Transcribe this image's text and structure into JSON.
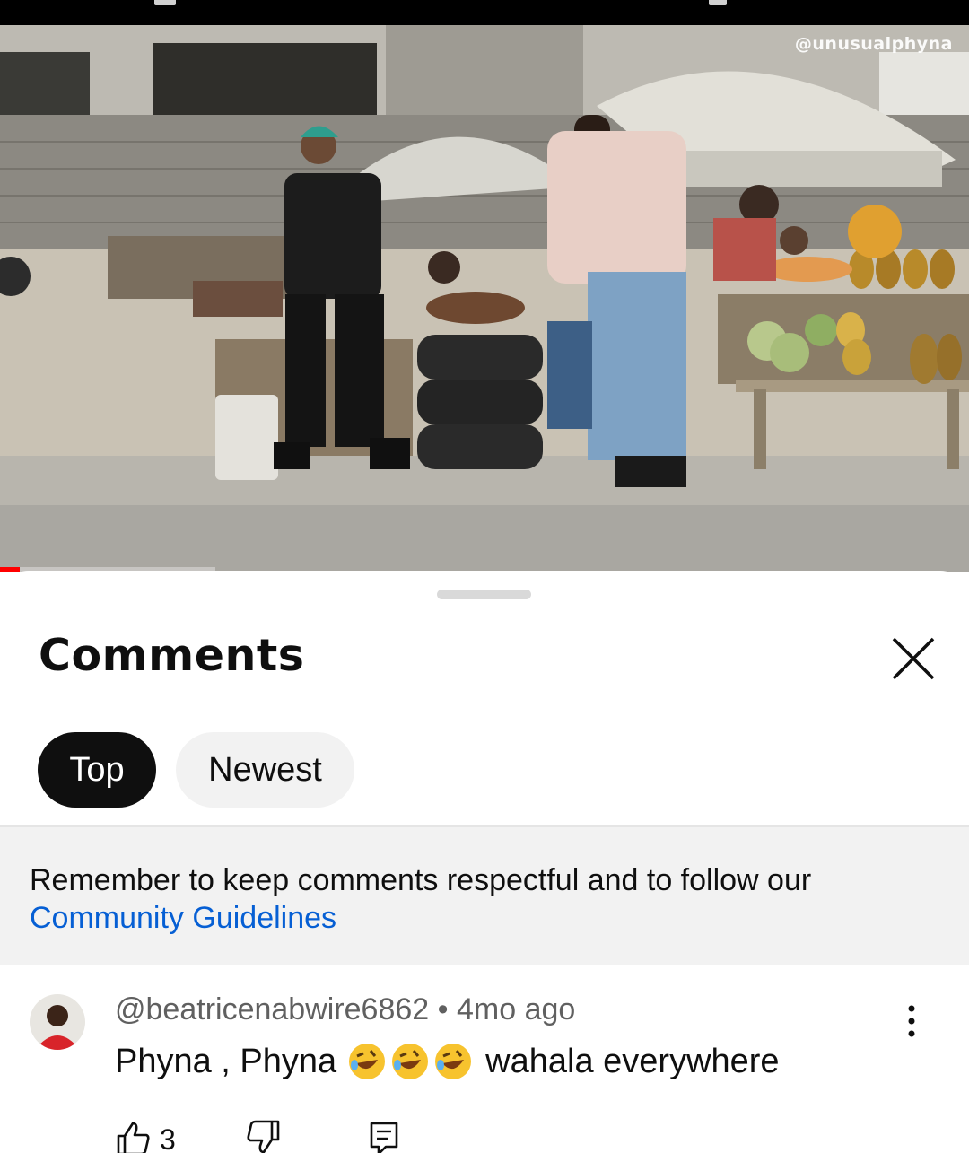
{
  "video": {
    "watermark": "@unusualphyna",
    "progress_fraction": 0.02
  },
  "comments_panel": {
    "title": "Comments",
    "close_icon": "close-icon",
    "sort_chips": [
      {
        "label": "Top",
        "selected": true
      },
      {
        "label": "Newest",
        "selected": false
      }
    ],
    "notice": {
      "text": "Remember to keep comments respectful and to follow our",
      "link": "Community Guidelines"
    }
  },
  "comments": [
    {
      "author": "@beatricenabwire6862",
      "separator": "•",
      "time": "4mo ago",
      "text_before": "Phyna , Phyna",
      "emoji": [
        "rolling-laughing-emoji",
        "rolling-laughing-emoji",
        "rolling-laughing-emoji"
      ],
      "text_after": "wahala everywhere",
      "likes": "3"
    }
  ],
  "colors": {
    "link": "#065fd4",
    "chip_selected": "#0f0f0f",
    "chip_unselected": "#f2f2f2",
    "progress": "#ff0000"
  }
}
